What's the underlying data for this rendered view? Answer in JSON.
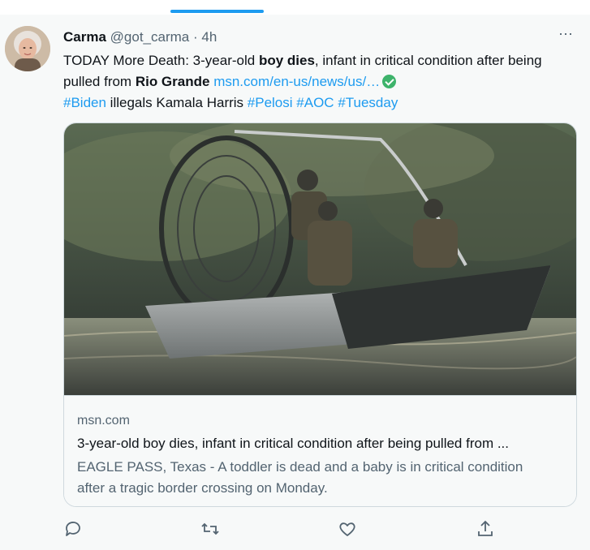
{
  "tweet": {
    "author_name": "Carma",
    "author_handle": "@got_carma",
    "separator": "·",
    "time": "4h",
    "more_icon": "⋯",
    "text_part1": "TODAY More Death: 3-year-old ",
    "text_bold1": "boy dies",
    "text_part2": ", infant in critical condition after being pulled from ",
    "text_bold2": "Rio Grande",
    "text_link": "msn.com/en-us/news/us/…",
    "hashtag1": "#Biden",
    "plain_mid": " illegals Kamala Harris ",
    "hashtag2": "#Pelosi",
    "hashtag3": "#AOC",
    "hashtag4": "#Tuesday"
  },
  "card": {
    "domain": "msn.com",
    "title": "3-year-old boy dies, infant in critical condition after being pulled from ...",
    "description": "EAGLE PASS, Texas - A toddler is dead and a baby is in critical condition after a tragic border crossing on Monday."
  },
  "actions": [
    "reply-icon",
    "retweet-icon",
    "like-icon",
    "share-icon"
  ],
  "colors": {
    "accent": "#1d9bf0",
    "verified": "#3db36b",
    "muted": "#536471"
  }
}
